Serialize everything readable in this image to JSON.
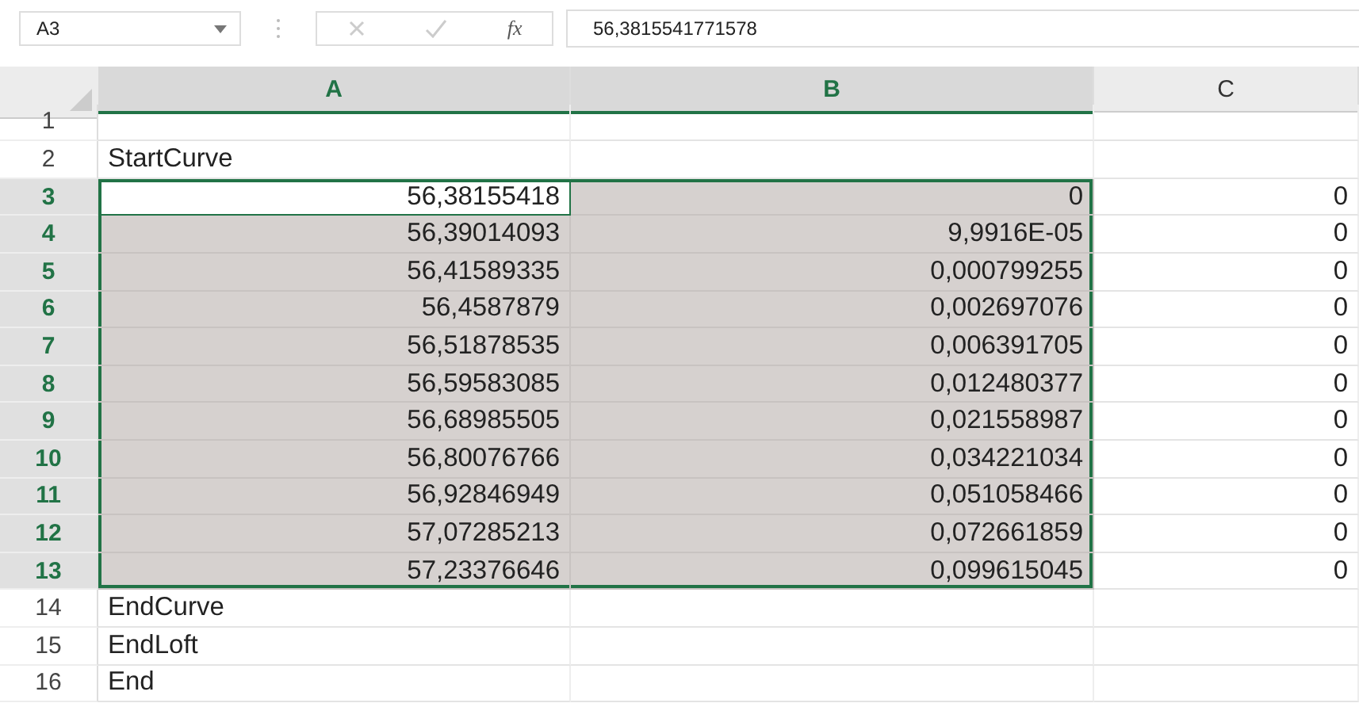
{
  "formula_bar": {
    "name_box": "A3",
    "function_label": "fx",
    "formula": "56,3815541771578"
  },
  "columns": [
    {
      "label": "A",
      "selected": true
    },
    {
      "label": "B",
      "selected": true
    },
    {
      "label": "C",
      "selected": false
    }
  ],
  "rows": [
    {
      "number": "1",
      "selected": false,
      "cells": [
        {
          "selected": false,
          "active": false
        },
        {
          "selected": false,
          "active": false
        },
        {
          "selected": false,
          "active": false
        }
      ]
    },
    {
      "number": "2",
      "selected": false,
      "cells": [
        {
          "text": "StartCurve",
          "kind": "text",
          "selected": false,
          "active": false
        },
        {
          "selected": false,
          "active": false
        },
        {
          "selected": false,
          "active": false
        }
      ]
    },
    {
      "number": "3",
      "selected": true,
      "cells": [
        {
          "text": "56,38155418",
          "kind": "number",
          "selected": true,
          "active": true
        },
        {
          "text": "0",
          "kind": "number",
          "selected": true,
          "active": false
        },
        {
          "text": "0",
          "kind": "number",
          "selected": false,
          "active": false
        }
      ]
    },
    {
      "number": "4",
      "selected": true,
      "cells": [
        {
          "text": "56,39014093",
          "kind": "number",
          "selected": true,
          "active": false
        },
        {
          "text": "9,9916E-05",
          "kind": "number",
          "selected": true,
          "active": false
        },
        {
          "text": "0",
          "kind": "number",
          "selected": false,
          "active": false
        }
      ]
    },
    {
      "number": "5",
      "selected": true,
      "cells": [
        {
          "text": "56,41589335",
          "kind": "number",
          "selected": true,
          "active": false
        },
        {
          "text": "0,000799255",
          "kind": "number",
          "selected": true,
          "active": false
        },
        {
          "text": "0",
          "kind": "number",
          "selected": false,
          "active": false
        }
      ]
    },
    {
      "number": "6",
      "selected": true,
      "cells": [
        {
          "text": "56,4587879",
          "kind": "number",
          "selected": true,
          "active": false
        },
        {
          "text": "0,002697076",
          "kind": "number",
          "selected": true,
          "active": false
        },
        {
          "text": "0",
          "kind": "number",
          "selected": false,
          "active": false
        }
      ]
    },
    {
      "number": "7",
      "selected": true,
      "cells": [
        {
          "text": "56,51878535",
          "kind": "number",
          "selected": true,
          "active": false
        },
        {
          "text": "0,006391705",
          "kind": "number",
          "selected": true,
          "active": false
        },
        {
          "text": "0",
          "kind": "number",
          "selected": false,
          "active": false
        }
      ]
    },
    {
      "number": "8",
      "selected": true,
      "cells": [
        {
          "text": "56,59583085",
          "kind": "number",
          "selected": true,
          "active": false
        },
        {
          "text": "0,012480377",
          "kind": "number",
          "selected": true,
          "active": false
        },
        {
          "text": "0",
          "kind": "number",
          "selected": false,
          "active": false
        }
      ]
    },
    {
      "number": "9",
      "selected": true,
      "cells": [
        {
          "text": "56,68985505",
          "kind": "number",
          "selected": true,
          "active": false
        },
        {
          "text": "0,021558987",
          "kind": "number",
          "selected": true,
          "active": false
        },
        {
          "text": "0",
          "kind": "number",
          "selected": false,
          "active": false
        }
      ]
    },
    {
      "number": "10",
      "selected": true,
      "cells": [
        {
          "text": "56,80076766",
          "kind": "number",
          "selected": true,
          "active": false
        },
        {
          "text": "0,034221034",
          "kind": "number",
          "selected": true,
          "active": false
        },
        {
          "text": "0",
          "kind": "number",
          "selected": false,
          "active": false
        }
      ]
    },
    {
      "number": "11",
      "selected": true,
      "cells": [
        {
          "text": "56,92846949",
          "kind": "number",
          "selected": true,
          "active": false
        },
        {
          "text": "0,051058466",
          "kind": "number",
          "selected": true,
          "active": false
        },
        {
          "text": "0",
          "kind": "number",
          "selected": false,
          "active": false
        }
      ]
    },
    {
      "number": "12",
      "selected": true,
      "cells": [
        {
          "text": "57,07285213",
          "kind": "number",
          "selected": true,
          "active": false
        },
        {
          "text": "0,072661859",
          "kind": "number",
          "selected": true,
          "active": false
        },
        {
          "text": "0",
          "kind": "number",
          "selected": false,
          "active": false
        }
      ]
    },
    {
      "number": "13",
      "selected": true,
      "cells": [
        {
          "text": "57,23376646",
          "kind": "number",
          "selected": true,
          "active": false
        },
        {
          "text": "0,099615045",
          "kind": "number",
          "selected": true,
          "active": false
        },
        {
          "text": "0",
          "kind": "number",
          "selected": false,
          "active": false
        }
      ]
    },
    {
      "number": "14",
      "selected": false,
      "cells": [
        {
          "text": "EndCurve",
          "kind": "text",
          "selected": false,
          "active": false
        },
        {
          "selected": false,
          "active": false
        },
        {
          "selected": false,
          "active": false
        }
      ]
    },
    {
      "number": "15",
      "selected": false,
      "cells": [
        {
          "text": "EndLoft",
          "kind": "text",
          "selected": false,
          "active": false
        },
        {
          "selected": false,
          "active": false
        },
        {
          "selected": false,
          "active": false
        }
      ]
    },
    {
      "number": "16",
      "selected": false,
      "cells": [
        {
          "text": "End",
          "kind": "text",
          "selected": false,
          "active": false
        },
        {
          "selected": false,
          "active": false
        },
        {
          "selected": false,
          "active": false
        }
      ]
    }
  ]
}
